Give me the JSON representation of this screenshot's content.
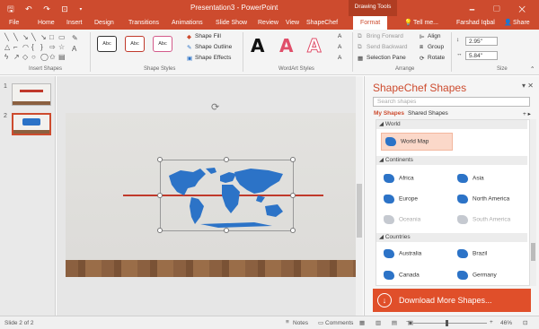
{
  "titlebar": {
    "quick_access": "🖫 ↶ ↷ ⊡ ▾",
    "title": "Presentation3 - PowerPoint",
    "context_tab_group": "Drawing Tools",
    "window_controls": "🗕 ▢ ✕"
  },
  "tabs": [
    "File",
    "Home",
    "Insert",
    "Design",
    "Transitions",
    "Animations",
    "Slide Show",
    "Review",
    "View",
    "ShapeChef",
    "Format"
  ],
  "active_tab": "Format",
  "tell_me": "Tell me...",
  "user": "Farshad Iqbal",
  "share": "Share",
  "ribbon": {
    "groups": {
      "insert_shapes": "Insert Shapes",
      "shape_styles": "Shape Styles",
      "wordart_styles": "WordArt Styles",
      "arrange": "Arrange",
      "size": "Size"
    },
    "style_presets": [
      "Abc",
      "Abc",
      "Abc"
    ],
    "shape_fill": "Shape Fill",
    "shape_outline": "Shape Outline",
    "shape_effects": "Shape Effects",
    "wordart_letters": [
      "A",
      "A",
      "A"
    ],
    "bring_forward": "Bring Forward",
    "send_backward": "Send Backward",
    "selection_pane": "Selection Pane",
    "align": "Align",
    "group": "Group",
    "rotate": "Rotate",
    "height": "2.95\"",
    "width": "5.84\""
  },
  "slides": [
    {
      "number": "1"
    },
    {
      "number": "2"
    }
  ],
  "pane": {
    "title": "ShapeChef Shapes",
    "search_placeholder": "Search shapes",
    "tabs": [
      "My Shapes",
      "Shared Shapes"
    ],
    "categories": [
      {
        "name": "World",
        "items": [
          {
            "label": "World Map",
            "highlight": true
          }
        ]
      },
      {
        "name": "Continents",
        "items": [
          {
            "label": "Africa"
          },
          {
            "label": "Asia"
          },
          {
            "label": "Europe"
          },
          {
            "label": "North America"
          },
          {
            "label": "Oceania",
            "disabled": true
          },
          {
            "label": "South America",
            "disabled": true
          }
        ]
      },
      {
        "name": "Countries",
        "items": [
          {
            "label": "Australia"
          },
          {
            "label": "Brazil"
          },
          {
            "label": "Canada"
          },
          {
            "label": "Germany"
          }
        ]
      }
    ],
    "download": "Download More Shapes..."
  },
  "status": {
    "slide_info": "Slide 2 of 2",
    "notes": "Notes",
    "comments": "Comments",
    "zoom": "46%"
  },
  "colors": {
    "accent": "#cd4b2e",
    "map_blue": "#2c73c7"
  }
}
